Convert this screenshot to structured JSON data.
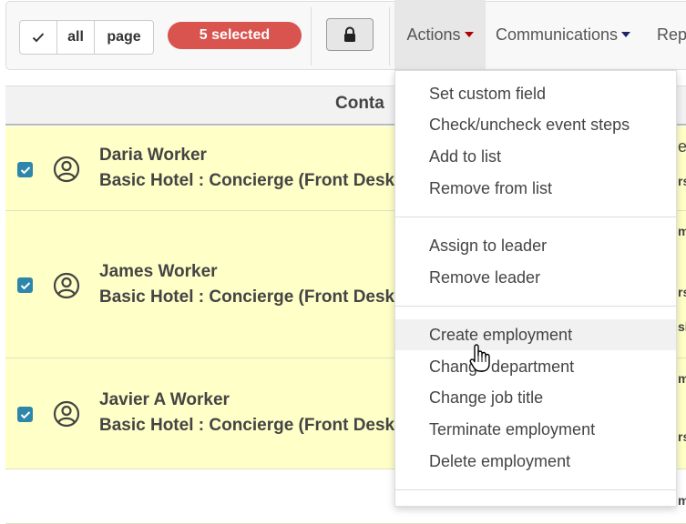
{
  "toolbar": {
    "check_icon": "check-icon",
    "all_label": "all",
    "page_label": "page",
    "selected_badge": "5 selected",
    "lock_icon": "lock-icon",
    "menus": [
      {
        "label": "Actions"
      },
      {
        "label": "Communications"
      },
      {
        "label": "Rep"
      }
    ]
  },
  "table": {
    "header_fragment": "Conta",
    "rows": [
      {
        "name": "Daria Worker",
        "job": "Basic Hotel : Concierge (Front Desk)"
      },
      {
        "name": "James Worker",
        "job": "Basic Hotel : Concierge (Front Desk)"
      },
      {
        "name": "Javier A Worker",
        "job": "Basic Hotel : Concierge (Front Desk)"
      }
    ],
    "right_fragments": [
      "e",
      "rs",
      "m",
      "rs",
      "si",
      "m",
      "rs",
      "m"
    ]
  },
  "actions_menu": {
    "groups": [
      [
        "Set custom field",
        "Check/uncheck event steps",
        "Add to list",
        "Remove from list"
      ],
      [
        "Assign to leader",
        "Remove leader"
      ],
      [
        "Create employment",
        "Change department",
        "Change job title",
        "Terminate employment",
        "Delete employment"
      ]
    ],
    "hovered_item": "Create employment"
  },
  "colors": {
    "badge": "#d9534f",
    "row_highlight": "#ffffc8",
    "checkbox": "#2e86ab",
    "actions_caret": "#b00000"
  }
}
